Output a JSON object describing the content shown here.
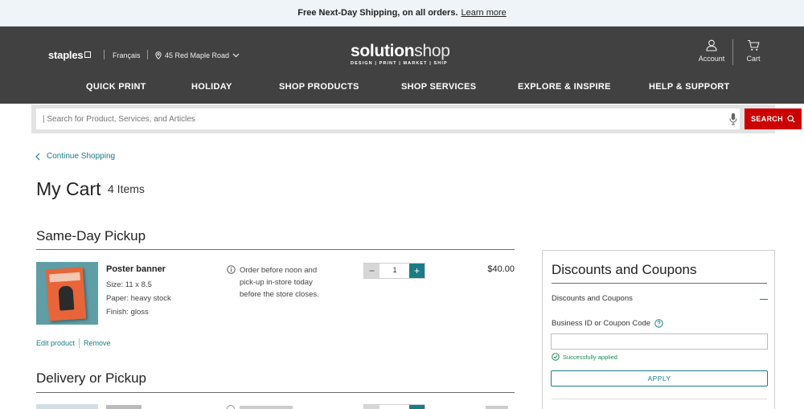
{
  "promo": {
    "text": "Free Next-Day Shipping, on all orders.",
    "link": "Learn more"
  },
  "header": {
    "brand": "staples",
    "language": "Français",
    "location": "45 Red Maple Road",
    "logo_bold": "solution",
    "logo_light": "shop",
    "logo_tagline": "DESIGN | PRINT | MARKET | SHIP",
    "account_label": "Account",
    "cart_label": "Cart",
    "nav": [
      "QUICK PRINT",
      "HOLIDAY",
      "SHOP PRODUCTS",
      "SHOP SERVICES",
      "EXPLORE & INSPIRE",
      "HELP & SUPPORT"
    ]
  },
  "search": {
    "placeholder": "| Search for Product, Services, and Articles",
    "button_label": "SEARCH"
  },
  "cart": {
    "continue_label": "Continue Shopping",
    "title": "My Cart",
    "count": "4 Items",
    "sections": [
      {
        "title": "Same-Day Pickup",
        "items": [
          {
            "name": "Poster banner",
            "specs": [
              "Size: 11 x 8.5",
              "Paper: heavy stock",
              "Finish: gloss"
            ],
            "note": "Order before noon and pick-up in-store today before the store closes.",
            "quantity": "1",
            "price": "$40.00",
            "edit_label": "Edit product",
            "remove_label": "Remove"
          }
        ]
      },
      {
        "title": "Delivery or Pickup"
      }
    ]
  },
  "discounts": {
    "title": "Discounts and Coupons",
    "accordion_label": "Discounts and Coupons",
    "field_label": "Business ID or Coupon Code",
    "field_value": "",
    "success_text": "Successfully applied",
    "apply_label": "APPLY"
  },
  "colors": {
    "accent": "#1a7b86",
    "search_button": "#cc0000",
    "header_bg": "#414141",
    "success": "#1f8a5a"
  }
}
